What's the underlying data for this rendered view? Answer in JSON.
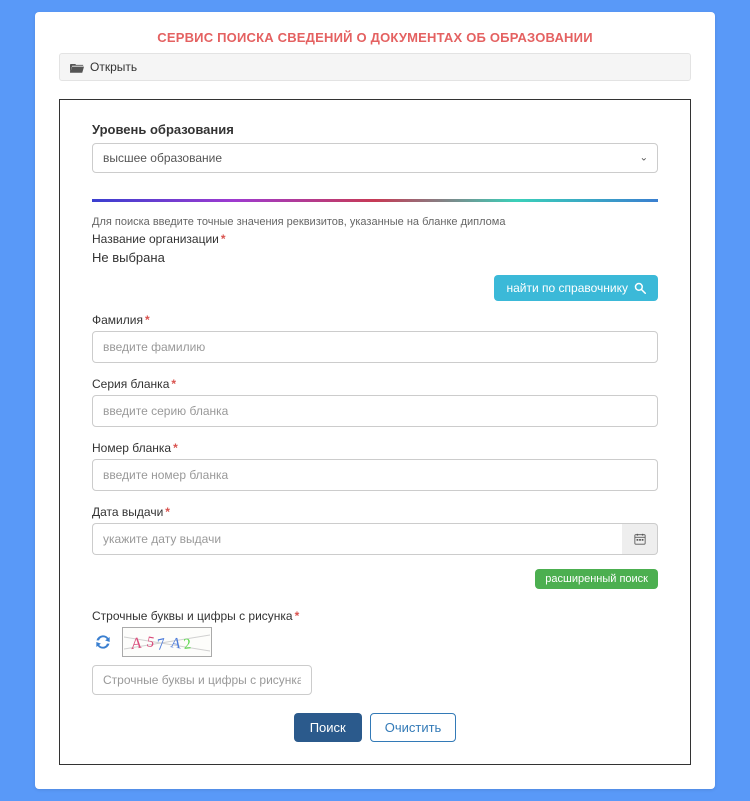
{
  "page": {
    "title": "СЕРВИС ПОИСКА СВЕДЕНИЙ О ДОКУМЕНТАХ ОБ ОБРАЗОВАНИИ",
    "open_label": "Открыть"
  },
  "form": {
    "level_label": "Уровень образования",
    "level_value": "высшее образование",
    "hint": "Для поиска введите точные значения реквизитов, указанные на бланке диплома",
    "org_label": "Название организации",
    "org_not_selected": "Не выбрана",
    "find_ref_label": "найти по справочнику",
    "surname_label": "Фамилия",
    "surname_placeholder": "введите фамилию",
    "series_label": "Серия бланка",
    "series_placeholder": "введите серию бланка",
    "number_label": "Номер бланка",
    "number_placeholder": "введите номер бланка",
    "date_label": "Дата выдачи",
    "date_placeholder": "укажите дату выдачи",
    "advanced_label": "расширенный поиск",
    "captcha_label": "Строчные буквы и цифры с рисунка",
    "captcha_placeholder": "Строчные буквы и цифры с рисунка",
    "search_btn": "Поиск",
    "clear_btn": "Очистить"
  }
}
